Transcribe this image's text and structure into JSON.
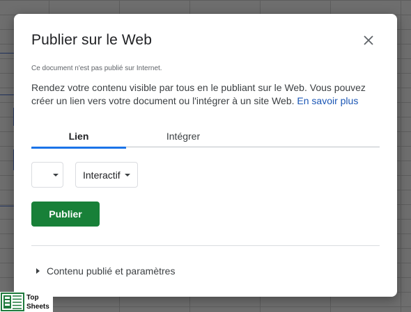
{
  "dialog": {
    "title": "Publier sur le Web",
    "close_icon": "close-icon",
    "status": "Ce document n'est pas publié sur Internet.",
    "description": "Rendez votre contenu visible par tous en le publiant sur le Web. Vous pouvez créer un lien vers votre document ou l'intégrer à un site Web.",
    "learn_more": "En savoir plus",
    "tabs": [
      {
        "label": "Lien",
        "active": true
      },
      {
        "label": "Intégrer",
        "active": false
      }
    ],
    "sheet_select": {
      "value": ""
    },
    "mode_select": {
      "value": "Interactif"
    },
    "publish_label": "Publier",
    "expander_label": "Contenu publié et paramètres"
  },
  "watermark": {
    "line1": "Top",
    "line2": "Sheets"
  },
  "colors": {
    "accent": "#1a73e8",
    "publish_button": "#188038",
    "link": "#1a56b5"
  }
}
